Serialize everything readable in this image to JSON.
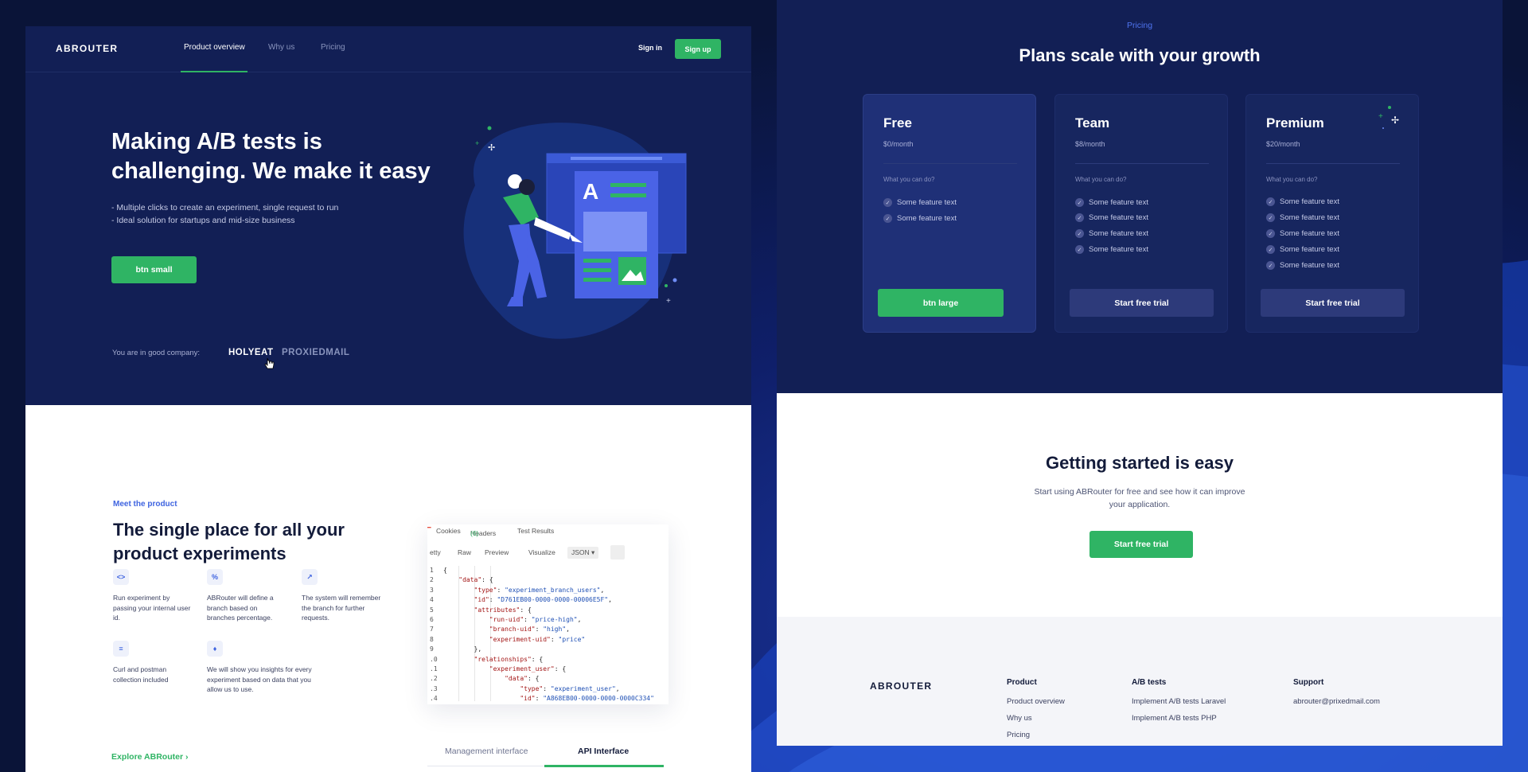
{
  "nav": {
    "logo": "ABROUTER",
    "links": [
      "Product overview",
      "Why us",
      "Pricing"
    ],
    "signin": "Sign in",
    "signup": "Sign up"
  },
  "hero": {
    "title": "Making A/B tests is challenging. We make it easy",
    "bullets": [
      "- Multiple clicks to create an experiment, single request to run",
      "- Ideal solution for startups and mid-size business"
    ],
    "button": "btn small",
    "company_label": "You are in good company:",
    "companies": [
      "HOLYEAT",
      "PROXIEDMAIL"
    ]
  },
  "product": {
    "eyebrow": "Meet the product",
    "title": "The single place for all your product experiments",
    "features": [
      {
        "icon": "code-icon",
        "glyph": "<>",
        "text": "Run experiment by passing your internal user id."
      },
      {
        "icon": "percent-icon",
        "glyph": "%",
        "text": "ABRouter will define a branch based on branches percentage."
      },
      {
        "icon": "chart-icon",
        "glyph": "↗",
        "text": "The system will remember the branch for further requests."
      },
      {
        "icon": "document-icon",
        "glyph": "≡",
        "text": "Curl and postman collection included"
      },
      {
        "icon": "lightbulb-icon",
        "glyph": "♦",
        "text": "We will show you insights for every experiment based on data that you allow us to use."
      }
    ],
    "explore": "Explore ABRouter",
    "code_tabs": {
      "cookies": "Cookies",
      "headers": "Headers",
      "headers_count": "(6)",
      "tests": "Test Results"
    },
    "code_toolbar": [
      "etty",
      "Raw",
      "Preview",
      "Visualize",
      "JSON"
    ],
    "code_line_numbers": [
      "1",
      "2",
      "3",
      "4",
      "5",
      "6",
      "7",
      "8",
      "9",
      ".0",
      ".1",
      ".2",
      ".3",
      ".4"
    ],
    "code_lines": [
      "{",
      "    \"data\": {",
      "        \"type\": \"experiment_branch_users\",",
      "        \"id\": \"D761EB00-0000-0000-00006E5F\",",
      "        \"attributes\": {",
      "            \"run-uid\": \"price-high\",",
      "            \"branch-uid\": \"high\",",
      "            \"experiment-uid\": \"price\"",
      "        },",
      "        \"relationships\": {",
      "            \"experiment_user\": {",
      "                \"data\": {",
      "                    \"type\": \"experiment_user\",",
      "                    \"id\": \"A868EB00-0000-0000-0000C334\""
    ],
    "tabs": [
      "Management interface",
      "API Interface"
    ]
  },
  "pricing": {
    "eyebrow": "Pricing",
    "title": "Plans scale with your growth",
    "question": "What you can do?",
    "plans": [
      {
        "name": "Free",
        "price": "$0/month",
        "features": [
          "Some feature text",
          "Some feature text"
        ],
        "button": "btn large"
      },
      {
        "name": "Team",
        "price": "$8/month",
        "features": [
          "Some feature text",
          "Some feature text",
          "Some feature text",
          "Some feature text"
        ],
        "button": "Start free trial"
      },
      {
        "name": "Premium",
        "price": "$20/month",
        "features": [
          "Some feature text",
          "Some feature text",
          "Some feature text",
          "Some feature text",
          "Some feature text"
        ],
        "button": "Start free trial"
      }
    ]
  },
  "start": {
    "title": "Getting started is easy",
    "subtitle": "Start using ABRouter for free and see how it can improve your application.",
    "button": "Start free trial"
  },
  "footer": {
    "logo": "ABROUTER",
    "columns": [
      {
        "title": "Product",
        "links": [
          "Product overview",
          "Why us",
          "Pricing"
        ]
      },
      {
        "title": "A/B tests",
        "links": [
          "Implement A/B tests Laravel",
          "Implement A/B tests PHP"
        ]
      },
      {
        "title": "Support",
        "links": [
          "abrouter@prixedmail.com"
        ]
      }
    ]
  },
  "colors": {
    "accent": "#2fb464",
    "navy": "#121f55",
    "link_blue": "#3f64e0"
  }
}
